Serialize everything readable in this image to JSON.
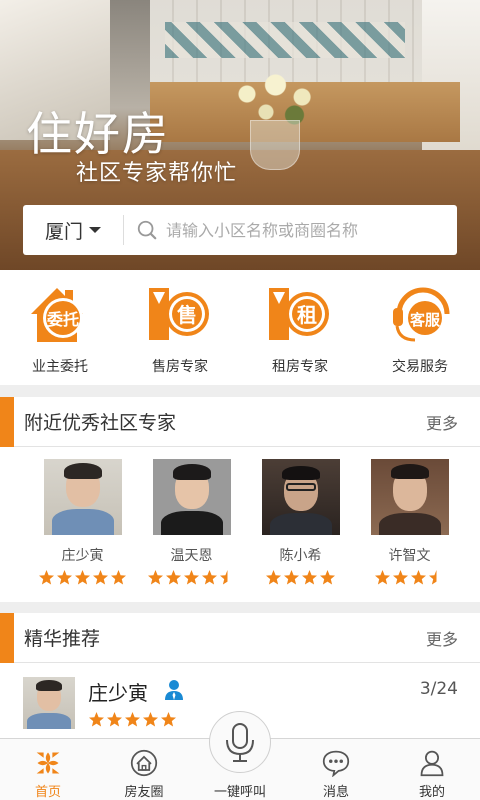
{
  "hero": {
    "brand_title": "住好房",
    "brand_subtitle": "社区专家帮你忙"
  },
  "search": {
    "city": "厦门",
    "placeholder": "请输入小区名称或商圈名称"
  },
  "actions": [
    {
      "label": "业主委托",
      "badge": "委托",
      "icon": "house-consign-icon"
    },
    {
      "label": "售房专家",
      "badge": "售",
      "icon": "sell-expert-icon"
    },
    {
      "label": "租房专家",
      "badge": "租",
      "icon": "rent-expert-icon"
    },
    {
      "label": "交易服务",
      "badge": "客服",
      "icon": "customer-service-icon"
    }
  ],
  "experts_section": {
    "title": "附近优秀社区专家",
    "more": "更多",
    "items": [
      {
        "name": "庄少寅",
        "rating": 5
      },
      {
        "name": "温天恩",
        "rating": 4.5
      },
      {
        "name": "陈小希",
        "rating": 4
      },
      {
        "name": "许智文",
        "rating": 3.5
      }
    ]
  },
  "featured_section": {
    "title": "精华推荐",
    "more": "更多",
    "items": [
      {
        "name": "庄少寅",
        "date": "3/24",
        "rating": 5,
        "verified_icon": "person-verified-icon"
      }
    ]
  },
  "tabbar": {
    "tabs": [
      {
        "label": "首页",
        "icon": "home-flower-icon",
        "active": true
      },
      {
        "label": "房友圈",
        "icon": "house-circle-icon",
        "active": false
      },
      {
        "label": "一键呼叫",
        "icon": "microphone-icon",
        "active": false
      },
      {
        "label": "消息",
        "icon": "message-bubble-icon",
        "active": false
      },
      {
        "label": "我的",
        "icon": "person-icon",
        "active": false
      }
    ]
  },
  "colors": {
    "accent": "#f08519",
    "blue": "#1a8ad4"
  }
}
